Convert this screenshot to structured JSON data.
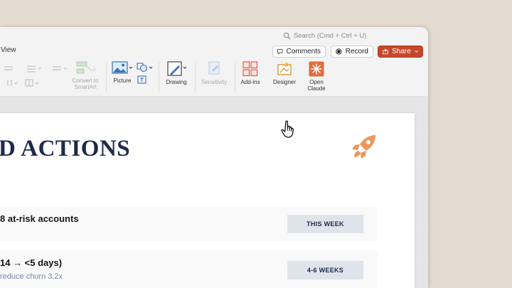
{
  "titlebar": {
    "search_placeholder": "Search (Cmd + Ctrl + U)"
  },
  "menu": {
    "view_tab": "View"
  },
  "actions": {
    "comments": "Comments",
    "record": "Record",
    "share": "Share"
  },
  "ribbon": {
    "smartart_label": "Convert to\nSmartArt",
    "picture_label": "Picture",
    "drawing_label": "Drawing",
    "sensitivity_label": "Sensitivity",
    "addins_label": "Add-ins",
    "designer_label": "Designer",
    "open_claude_label": "Open\nClaude"
  },
  "slide": {
    "title": "D ACTIONS",
    "rows": [
      {
        "text": "8 at-risk accounts",
        "badge": "THIS WEEK"
      },
      {
        "text": "14 → <5 days)",
        "sub": "reduce churn 3.2x",
        "badge": "4-6 WEEKS"
      }
    ]
  },
  "colors": {
    "share_button": "#c4472b",
    "title_navy": "#1e2a4a",
    "rocket_orange": "#f0965a",
    "badge_bg": "#dfe3ea",
    "background": "#e4dccf"
  }
}
